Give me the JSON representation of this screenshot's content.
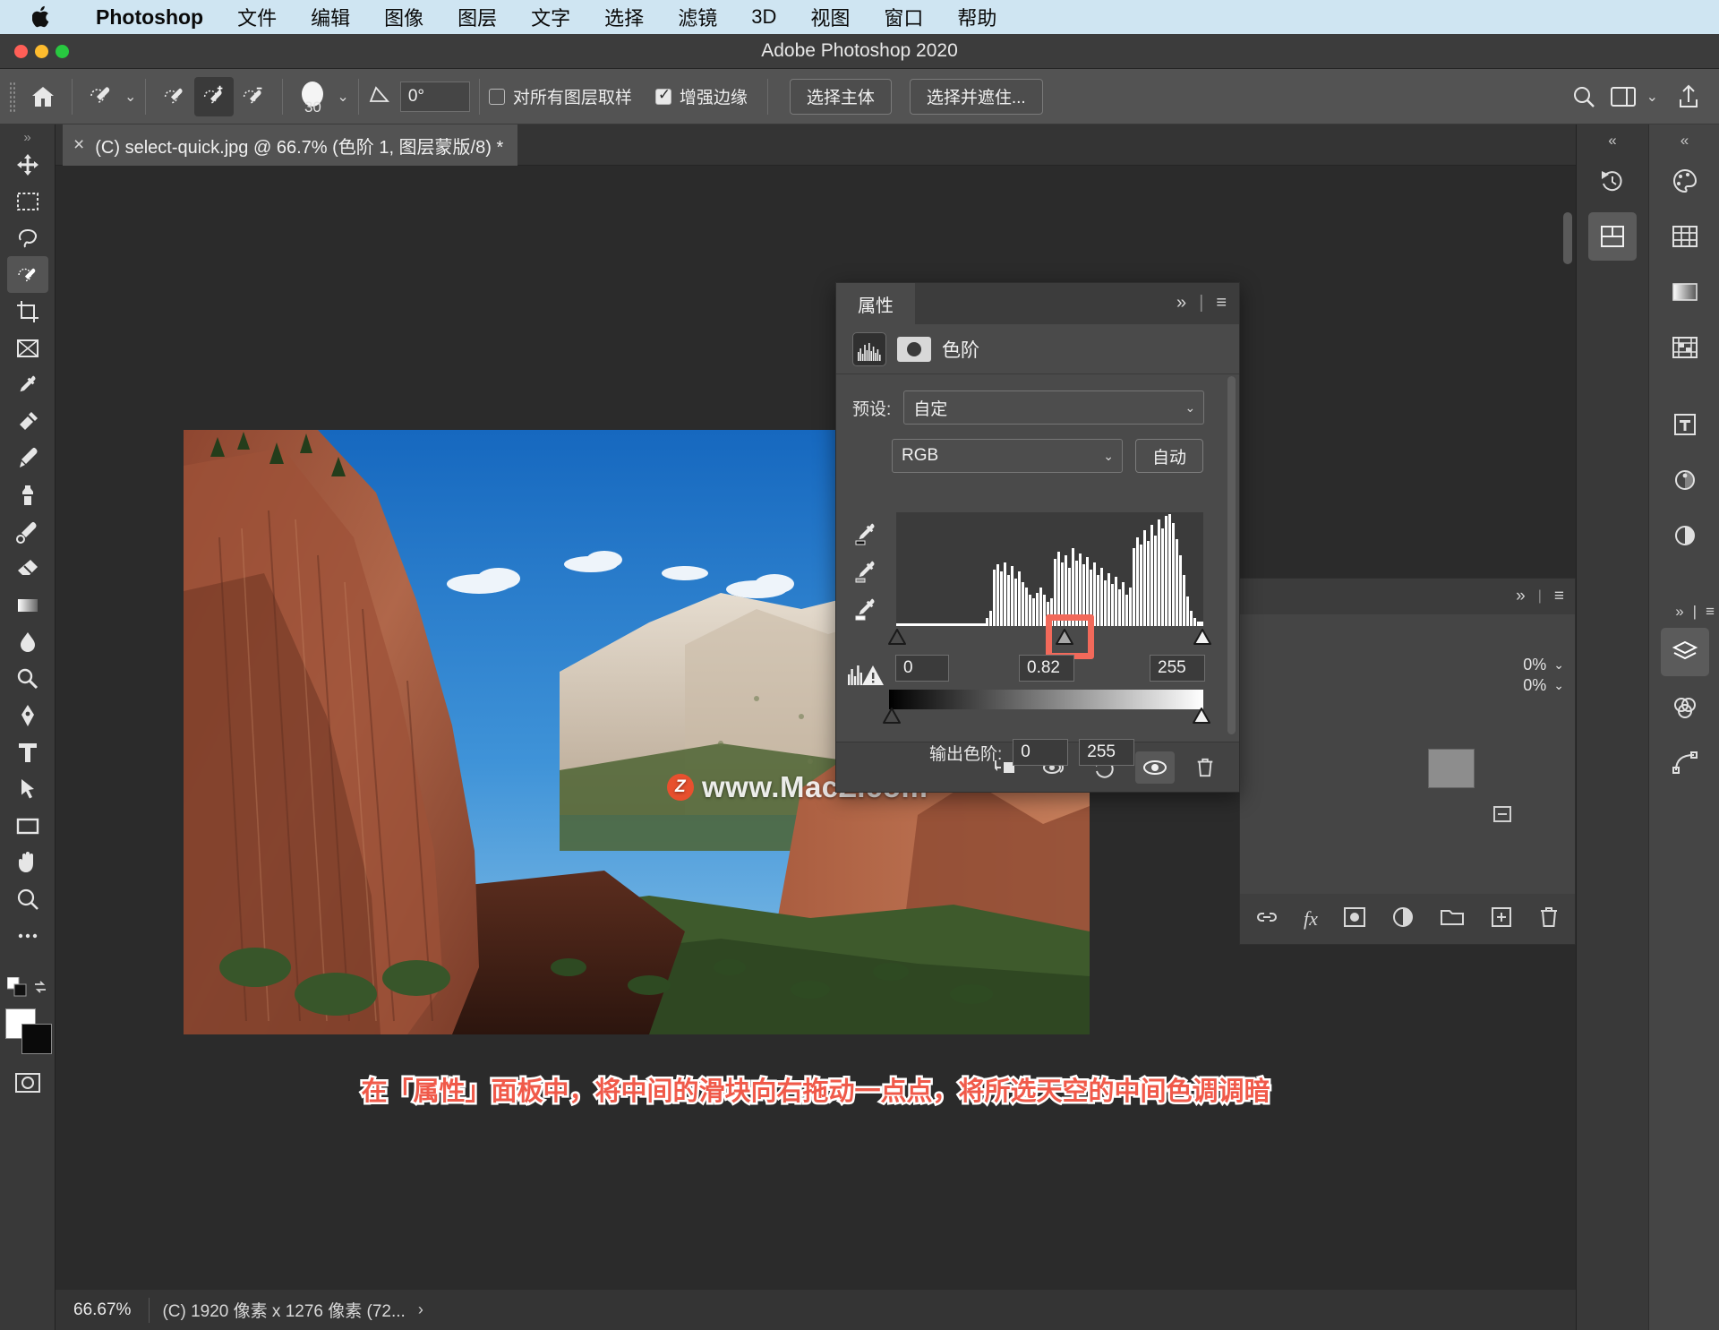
{
  "macmenu": {
    "apple": "apple-logo",
    "items": [
      {
        "label": "Photoshop",
        "bold": true
      },
      {
        "label": "文件"
      },
      {
        "label": "编辑"
      },
      {
        "label": "图像"
      },
      {
        "label": "图层"
      },
      {
        "label": "文字"
      },
      {
        "label": "选择"
      },
      {
        "label": "滤镜"
      },
      {
        "label": "3D"
      },
      {
        "label": "视图"
      },
      {
        "label": "窗口"
      },
      {
        "label": "帮助"
      }
    ]
  },
  "window": {
    "title": "Adobe Photoshop 2020"
  },
  "optionsbar": {
    "home_icon": "home-icon",
    "tool_preset": "quick-selection-tool",
    "mode_new": "selection-new",
    "mode_add": "selection-add",
    "mode_subtract": "selection-subtract",
    "brush_size": "30",
    "angle_label": "angle-icon",
    "angle_value": "0°",
    "sample_all_layers": "对所有图层取样",
    "sample_all_checked": false,
    "enhance_edge": "增强边缘",
    "enhance_edge_checked": true,
    "select_subject": "选择主体",
    "select_and_mask": "选择并遮住...",
    "search_icon": "search-icon",
    "workspace_icon": "workspace-icon",
    "share_icon": "share-icon"
  },
  "document": {
    "tab_title": "(C) select-quick.jpg @ 66.7% (色阶 1, 图层蒙版/8) *",
    "close_icon": "close-icon"
  },
  "watermark": {
    "badge": "Z",
    "text": "www.MacZ.com"
  },
  "caption": {
    "text": "在「属性」面板中，将中间的滑块向右拖动一点点，将所选天空的中间色调调暗"
  },
  "statusbar": {
    "zoom": "66.67%",
    "dimensions": "(C) 1920 像素 x 1276 像素 (72...",
    "arrow": "›"
  },
  "toolbox": {
    "tools": [
      {
        "name": "move-tool",
        "icon": "move"
      },
      {
        "name": "rectangular-marquee-tool",
        "icon": "marquee"
      },
      {
        "name": "lasso-tool",
        "icon": "lasso"
      },
      {
        "name": "quick-selection-tool",
        "icon": "quickselect",
        "selected": true
      },
      {
        "name": "crop-tool",
        "icon": "crop"
      },
      {
        "name": "frame-tool",
        "icon": "frame"
      },
      {
        "name": "eyedropper-tool",
        "icon": "eyedropper"
      },
      {
        "name": "spot-healing-brush-tool",
        "icon": "heal"
      },
      {
        "name": "brush-tool",
        "icon": "brush"
      },
      {
        "name": "clone-stamp-tool",
        "icon": "stamp"
      },
      {
        "name": "history-brush-tool",
        "icon": "historybrush"
      },
      {
        "name": "eraser-tool",
        "icon": "eraser"
      },
      {
        "name": "gradient-tool",
        "icon": "gradient"
      },
      {
        "name": "blur-tool",
        "icon": "blur"
      },
      {
        "name": "dodge-tool",
        "icon": "dodge"
      },
      {
        "name": "pen-tool",
        "icon": "pen"
      },
      {
        "name": "type-tool",
        "icon": "type"
      },
      {
        "name": "path-selection-tool",
        "icon": "pathselect"
      },
      {
        "name": "rectangle-tool",
        "icon": "rectangle"
      },
      {
        "name": "hand-tool",
        "icon": "hand"
      },
      {
        "name": "zoom-tool",
        "icon": "zoom"
      },
      {
        "name": "more-tools",
        "icon": "ellipsis"
      }
    ],
    "quickmask_icon": "quick-mask-icon",
    "screenmode_icon": "screen-mode-icon"
  },
  "properties": {
    "tab_label": "属性",
    "collapse_icon": "chevron-double-right-icon",
    "menu_icon": "panel-menu-icon",
    "adjustment_name": "色阶",
    "histogram_icon": "levels-histogram-icon",
    "mask_icon": "layer-mask-icon",
    "preset_label": "预设:",
    "preset_value": "自定",
    "channel_value": "RGB",
    "auto_button": "自动",
    "eyedropper_black": "set-black-point-eyedropper",
    "eyedropper_gray": "set-gray-point-eyedropper",
    "eyedropper_white": "set-white-point-eyedropper",
    "warning_icon": "histogram-refresh-warning-icon",
    "input_levels": {
      "black": "0",
      "gamma": "0.82",
      "white": "255"
    },
    "output_label": "输出色阶:",
    "output_levels": {
      "black": "0",
      "white": "255"
    },
    "highlight_color": "#f2695a",
    "bottom_icons": [
      {
        "name": "clip-to-layer-button",
        "glyph": "clip"
      },
      {
        "name": "view-previous-state-button",
        "glyph": "prev"
      },
      {
        "name": "reset-adjustment-button",
        "glyph": "reset"
      },
      {
        "name": "toggle-layer-visibility-button",
        "glyph": "eye",
        "active": true
      },
      {
        "name": "delete-adjustment-layer-button",
        "glyph": "trash"
      }
    ]
  },
  "layers_panel": {
    "opacity_value": "0%",
    "fill_value": "0%",
    "bottom_icons": [
      {
        "name": "link-layers-button",
        "glyph": "link"
      },
      {
        "name": "layer-style-button",
        "glyph": "fx"
      },
      {
        "name": "add-layer-mask-button",
        "glyph": "mask"
      },
      {
        "name": "new-adjustment-layer-button",
        "glyph": "adjust"
      },
      {
        "name": "new-group-button",
        "glyph": "folder"
      },
      {
        "name": "new-layer-button",
        "glyph": "plus"
      },
      {
        "name": "delete-layer-button",
        "glyph": "trash"
      }
    ]
  },
  "right_dock": {
    "top_icons": [
      {
        "name": "history-panel-icon"
      },
      {
        "name": "libraries-panel-icon",
        "selected": true
      }
    ],
    "rail_icons": [
      {
        "name": "color-panel-icon"
      },
      {
        "name": "swatches-panel-icon"
      },
      {
        "name": "gradients-panel-icon"
      },
      {
        "name": "patterns-panel-icon"
      },
      {
        "name": "character-panel-icon"
      },
      {
        "name": "adjustments-panel-icon"
      },
      {
        "name": "styles-panel-icon"
      },
      {
        "name": "layers-panel-icon",
        "selected": true
      },
      {
        "name": "channels-panel-icon"
      },
      {
        "name": "paths-panel-icon"
      }
    ]
  },
  "colors": {
    "menubar_bg": "#cfe5f2",
    "panel_bg": "#4a4a4a",
    "app_bg": "#2b2b2b",
    "accent": "#f2695a"
  }
}
